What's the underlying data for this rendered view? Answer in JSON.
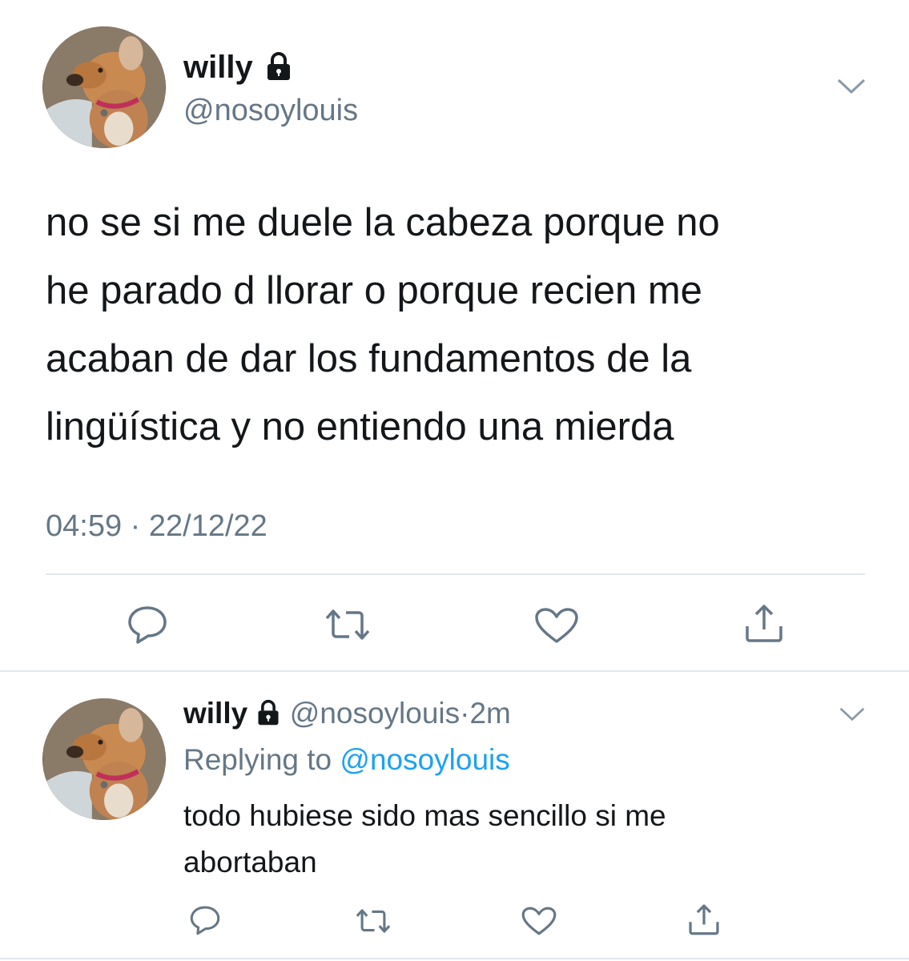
{
  "tweet": {
    "author": {
      "name": "willy",
      "handle": "@nosoylouis",
      "avatar_icon": "dog-avatar",
      "protected_icon": "lock-icon"
    },
    "text_lines": [
      "no se si me duele la cabeza porque no",
      "he parado d llorar o porque recien me",
      "acaban de dar los fundamentos de la",
      "lingüística y no entiendo una mierda"
    ],
    "time": "04:59",
    "date": "22/12/22",
    "actions": [
      "reply-icon",
      "retweet-icon",
      "like-icon",
      "share-icon"
    ]
  },
  "reply": {
    "author": {
      "name": "willy",
      "handle": "@nosoylouis",
      "protected_icon": "lock-icon"
    },
    "age": "2m",
    "replying_label": "Replying to",
    "replying_to": "@nosoylouis",
    "text_lines": [
      "todo hubiese sido mas sencillo si me",
      "abortaban"
    ],
    "actions": [
      "reply-icon",
      "retweet-icon",
      "like-icon",
      "share-icon"
    ]
  },
  "colors": {
    "text": "#14171a",
    "muted": "#657786",
    "link": "#1da1f2",
    "divider": "#e1e8ed"
  }
}
